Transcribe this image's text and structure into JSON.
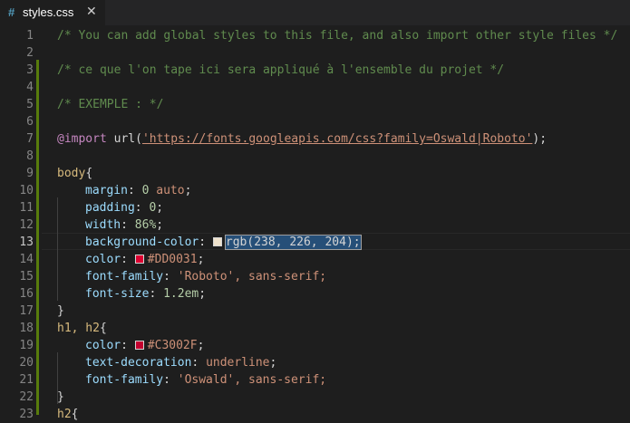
{
  "tab": {
    "icon": "#",
    "filename": "styles.css",
    "close": "✕"
  },
  "line_numbers": [
    "1",
    "2",
    "3",
    "4",
    "5",
    "6",
    "7",
    "8",
    "9",
    "10",
    "11",
    "12",
    "13",
    "14",
    "15",
    "16",
    "17",
    "18",
    "19",
    "20",
    "21",
    "22",
    "23"
  ],
  "code": {
    "l1": "/* You can add global styles to this file, and also import other style files */",
    "l3": "/* ce que l'on tape ici sera appliqué à l'ensemble du projet */",
    "l5": "/* EXEMPLE : */",
    "l7_at": "@import",
    "l7_fn_open": " url(",
    "l7_str": "'https://fonts.googleapis.com/css?family=Oswald|Roboto'",
    "l7_close": ");",
    "l9_sel": "body",
    "l9_brace": "{",
    "l10_prop": "margin",
    "l10_colon": ": ",
    "l10_num": "0",
    "l10_val": " auto",
    "l10_end": ";",
    "l11_prop": "padding",
    "l11_num": "0",
    "l12_prop": "width",
    "l12_num": "86%",
    "l13_prop": "background-color",
    "l13_val": "rgb(238, 226, 204);",
    "l13_swatch": "#eee2cc",
    "l14_prop": "color",
    "l14_val": "#DD0031",
    "l14_swatch": "#DD0031",
    "l15_prop": "font-family",
    "l15_val": "'Roboto'",
    "l15_rest": ", sans-serif;",
    "l16_prop": "font-size",
    "l16_num": "1.2em",
    "l17": "}",
    "l18_sel": "h1, h2",
    "l18_brace": "{",
    "l19_prop": "color",
    "l19_val": "#C3002F",
    "l19_swatch": "#C3002F",
    "l20_prop": "text-decoration",
    "l20_val": "underline",
    "l21_prop": "font-family",
    "l21_val": "'Oswald'",
    "l21_rest": ", sans-serif;",
    "l22": "}",
    "l23_sel": "h2",
    "l23_brace": "{"
  }
}
